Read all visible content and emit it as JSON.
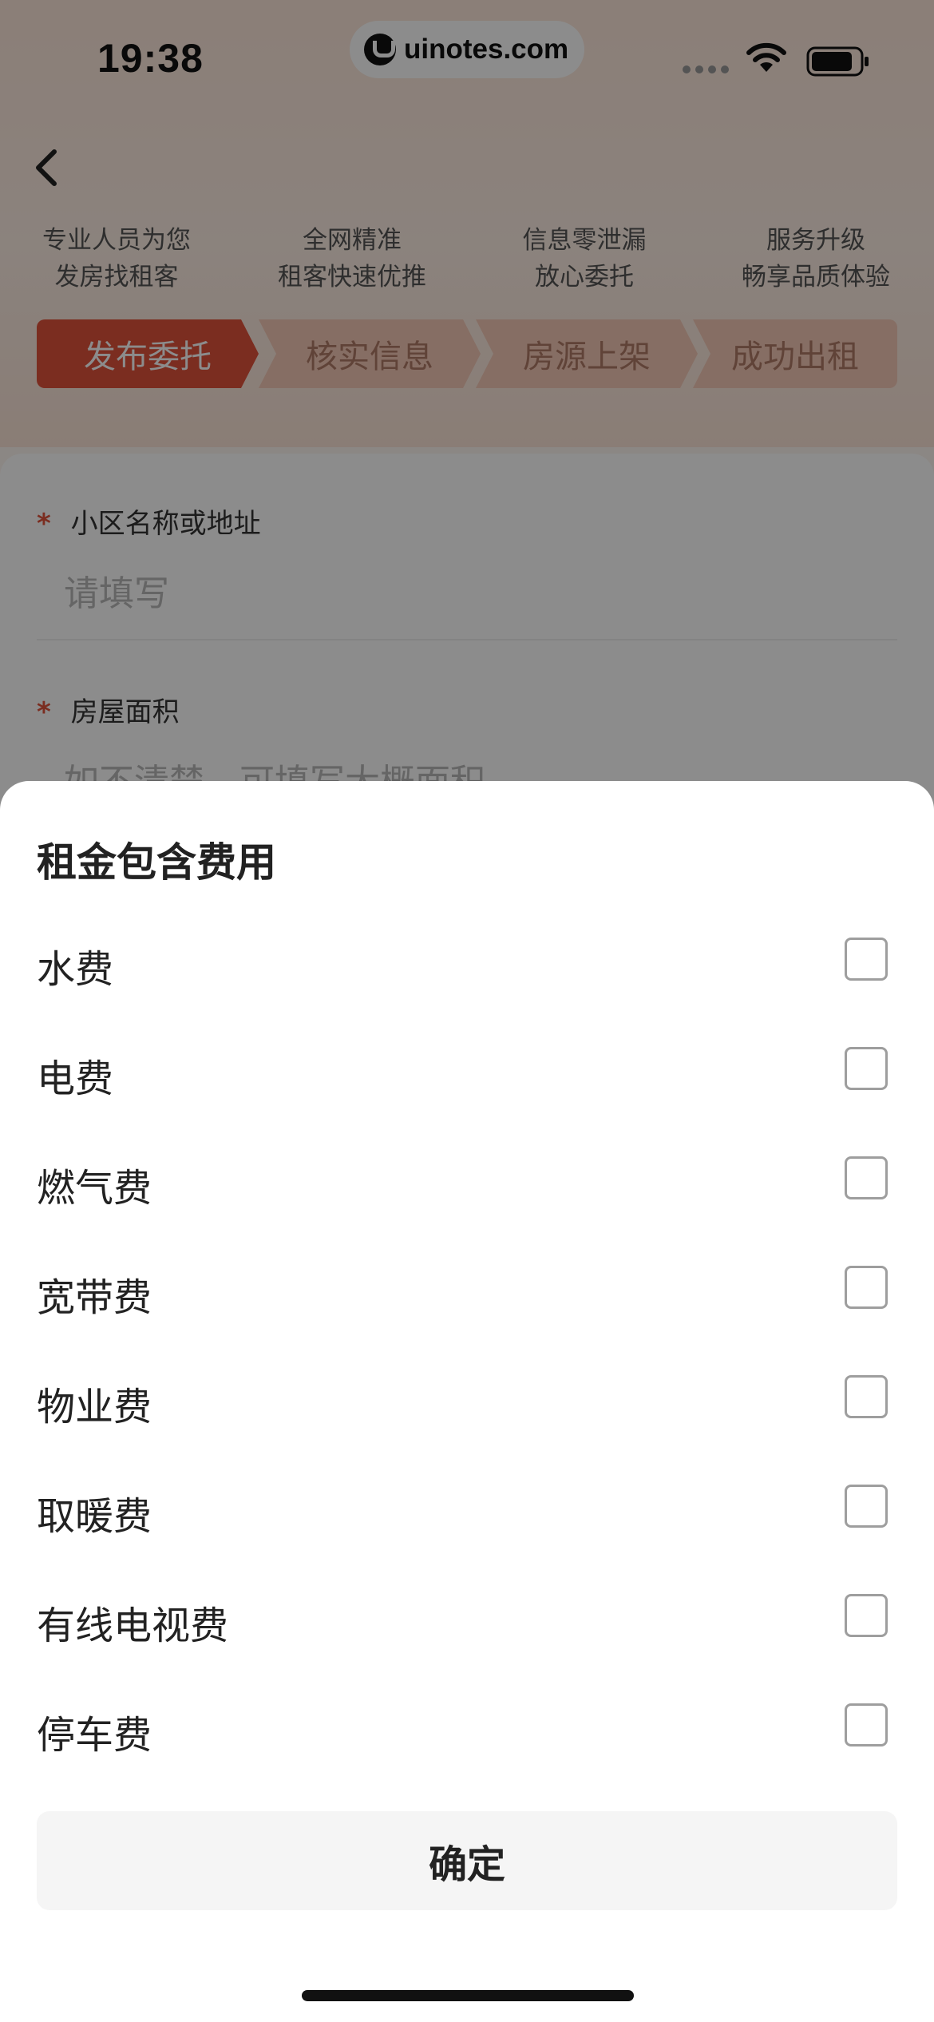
{
  "status_bar": {
    "time": "19:38",
    "url": "uinotes.com"
  },
  "features": [
    {
      "line1": "专业人员为您",
      "line2": "发房找租客"
    },
    {
      "line1": "全网精准",
      "line2": "租客快速优推"
    },
    {
      "line1": "信息零泄漏",
      "line2": "放心委托"
    },
    {
      "line1": "服务升级",
      "line2": "畅享品质体验"
    }
  ],
  "steps": [
    "发布委托",
    "核实信息",
    "房源上架",
    "成功出租"
  ],
  "form": {
    "address_label": "小区名称或地址",
    "address_placeholder": "请填写",
    "area_label": "房屋面积",
    "area_placeholder": "如不清楚，可填写大概面积",
    "required_mark": "*"
  },
  "sheet": {
    "title": "租金包含费用",
    "options": [
      {
        "label": "水费",
        "checked": false
      },
      {
        "label": "电费",
        "checked": false
      },
      {
        "label": "燃气费",
        "checked": false
      },
      {
        "label": "宽带费",
        "checked": false
      },
      {
        "label": "物业费",
        "checked": false
      },
      {
        "label": "取暖费",
        "checked": false
      },
      {
        "label": "有线电视费",
        "checked": false
      },
      {
        "label": "停车费",
        "checked": false
      }
    ],
    "confirm_label": "确定"
  },
  "colors": {
    "accent": "#e0523b",
    "step_inactive": "#f4c8b6"
  }
}
